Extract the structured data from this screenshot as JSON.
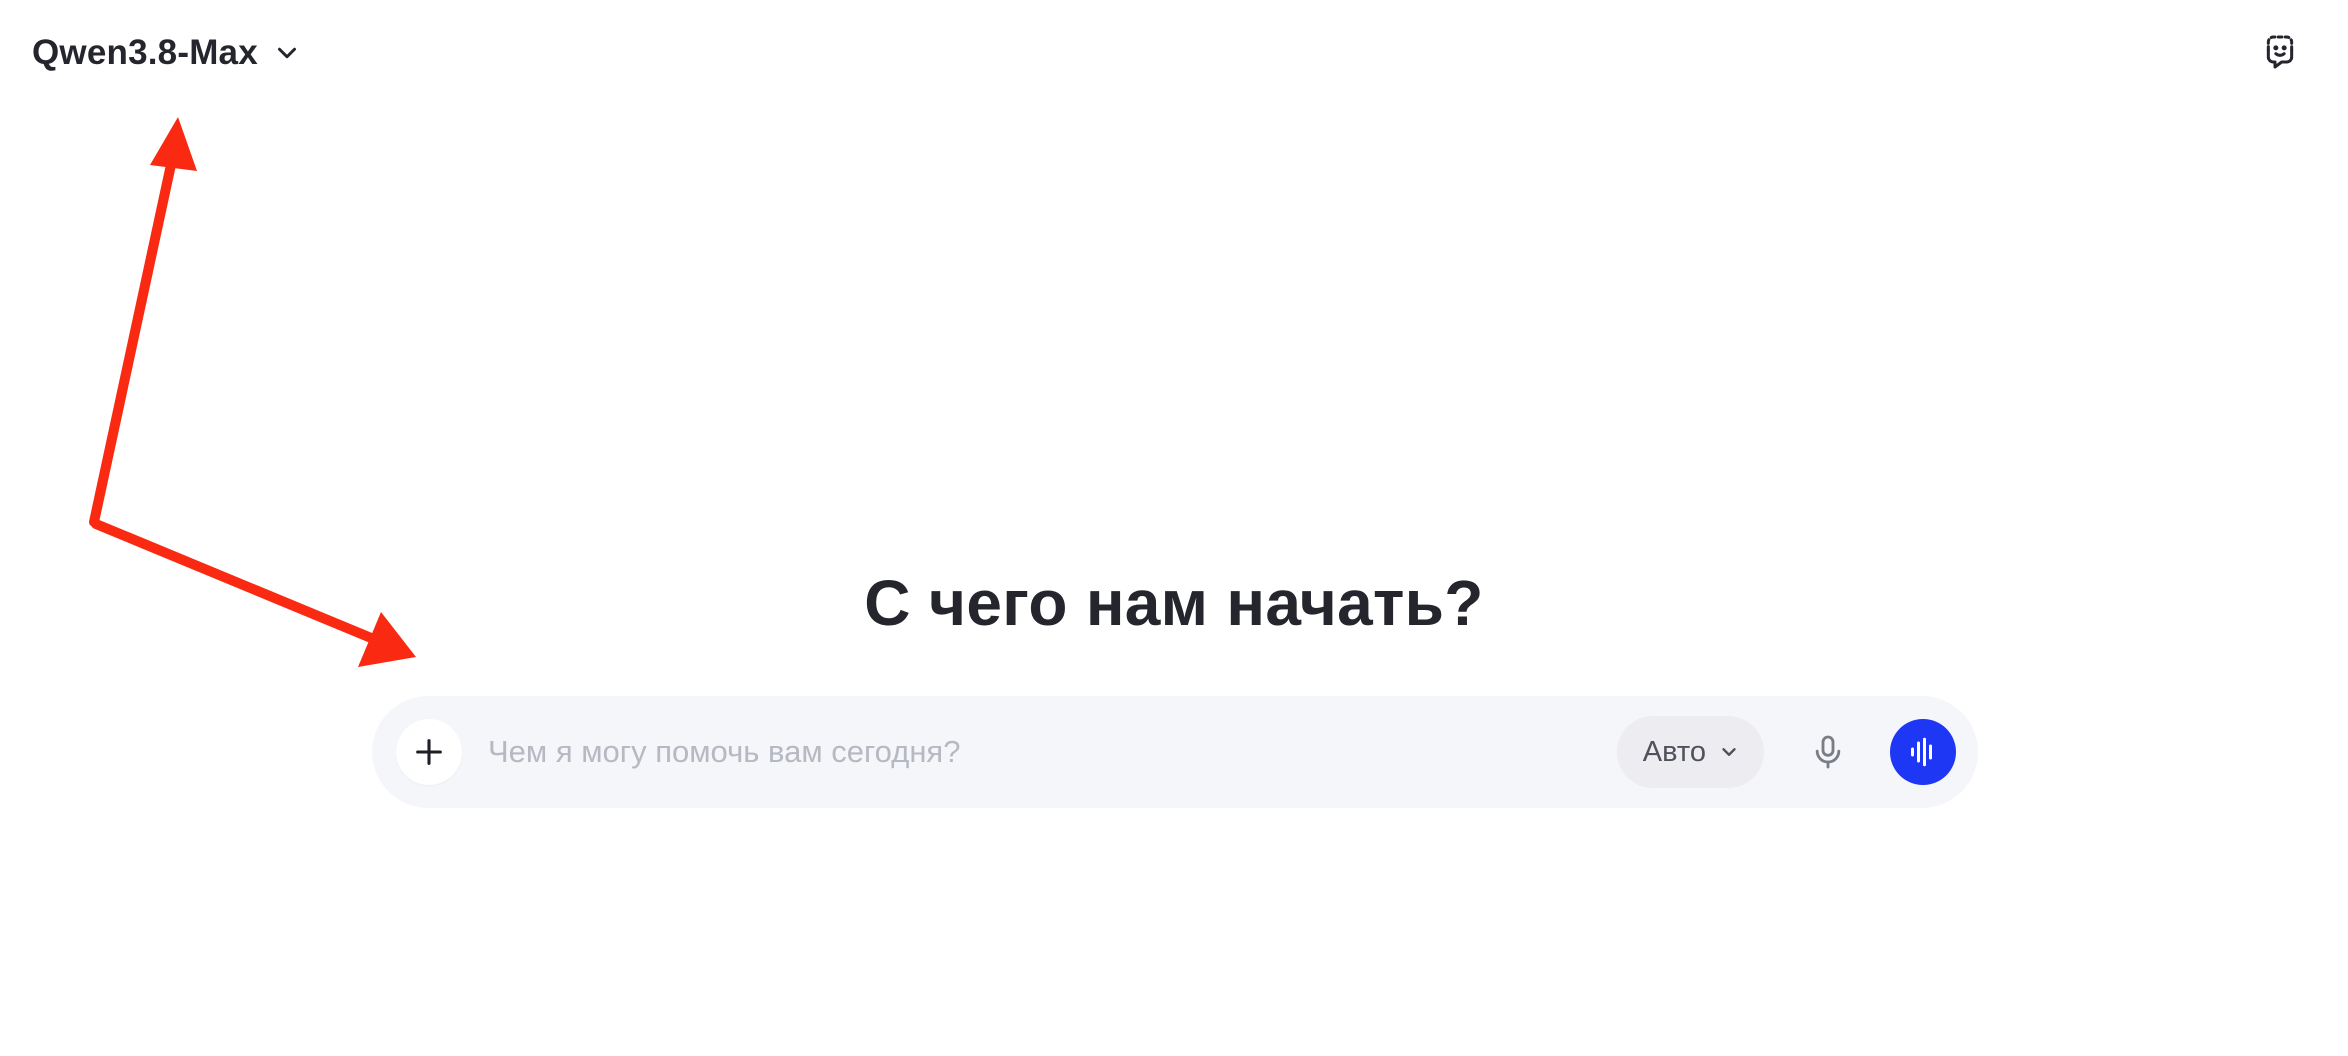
{
  "header": {
    "model_name": "Qwen3.8-Max",
    "model_dropdown_icon": "chevron-down-icon",
    "right_action_icon": "temporary-chat-icon"
  },
  "main": {
    "greeting": "С чего нам начать?"
  },
  "composer": {
    "add_icon": "plus-icon",
    "placeholder": "Чем я могу помочь вам сегодня?",
    "value": "",
    "mode_label": "Авто",
    "mode_icon": "chevron-down-icon",
    "mic_icon": "microphone-icon",
    "voice_icon": "voice-wave-icon"
  },
  "annotations": {
    "arrow_color": "#fa2a12",
    "arrow_icon": "annotation-arrow"
  },
  "colors": {
    "accent": "#1d37f5",
    "composer_bg": "#f5f6fa",
    "text_primary": "#25252d",
    "placeholder": "#b6b8c2"
  }
}
